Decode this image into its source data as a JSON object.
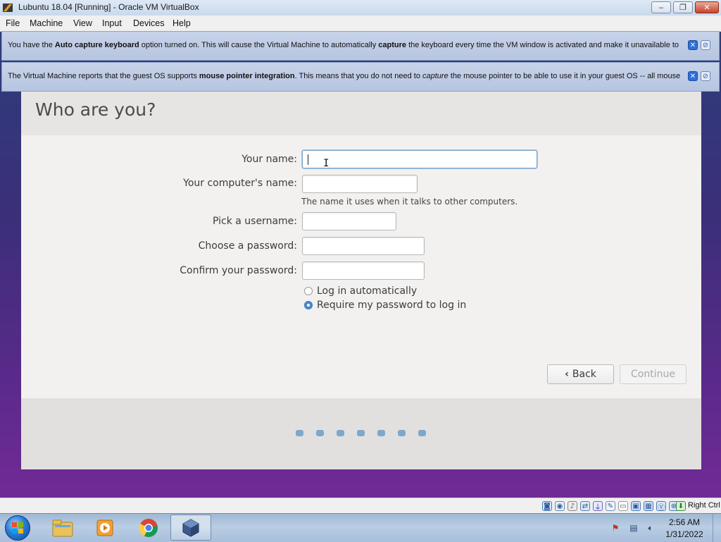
{
  "window": {
    "title": "Lubuntu 18.04 [Running] - Oracle VM VirtualBox",
    "minimize": "‒",
    "maximize": "❐",
    "close": "✕"
  },
  "menubar": {
    "items": [
      "File",
      "Machine",
      "View",
      "Input",
      "Devices",
      "Help"
    ]
  },
  "banners": [
    {
      "parts": [
        {
          "t": "You have the ",
          "style": "normal"
        },
        {
          "t": "Auto capture keyboard",
          "style": "bold"
        },
        {
          "t": " option turned on. This will cause the Virtual Machine to automatically ",
          "style": "normal"
        },
        {
          "t": "capture",
          "style": "bold"
        },
        {
          "t": " the keyboard every time the VM window is activated and make it unavailable to",
          "style": "normal"
        }
      ]
    },
    {
      "parts": [
        {
          "t": "The Virtual Machine reports that the guest OS supports ",
          "style": "normal"
        },
        {
          "t": "mouse pointer integration",
          "style": "bold"
        },
        {
          "t": ". This means that you do not need to ",
          "style": "normal"
        },
        {
          "t": "capture",
          "style": "italic"
        },
        {
          "t": " the mouse pointer to be able to use it in your guest OS -- all mouse",
          "style": "normal"
        }
      ]
    }
  ],
  "installer": {
    "heading": "Who are you?",
    "labels": {
      "your_name": "Your name:",
      "computer_name": "Your computer's name:",
      "username": "Pick a username:",
      "password": "Choose a password:",
      "confirm": "Confirm your password:"
    },
    "values": {
      "your_name": "",
      "computer_name": "",
      "username": "",
      "password": "",
      "confirm": ""
    },
    "computer_name_hint": "The name it uses when it talks to other computers.",
    "login_options": [
      {
        "label": "Log in automatically",
        "selected": false
      },
      {
        "label": "Require my password to log in",
        "selected": true
      }
    ],
    "back_label": "Back",
    "continue_label": "Continue",
    "progress_steps": 7
  },
  "statusbar": {
    "host_key": "Right Ctrl"
  },
  "taskbar": {
    "time": "2:56 AM",
    "date": "1/31/2022"
  }
}
